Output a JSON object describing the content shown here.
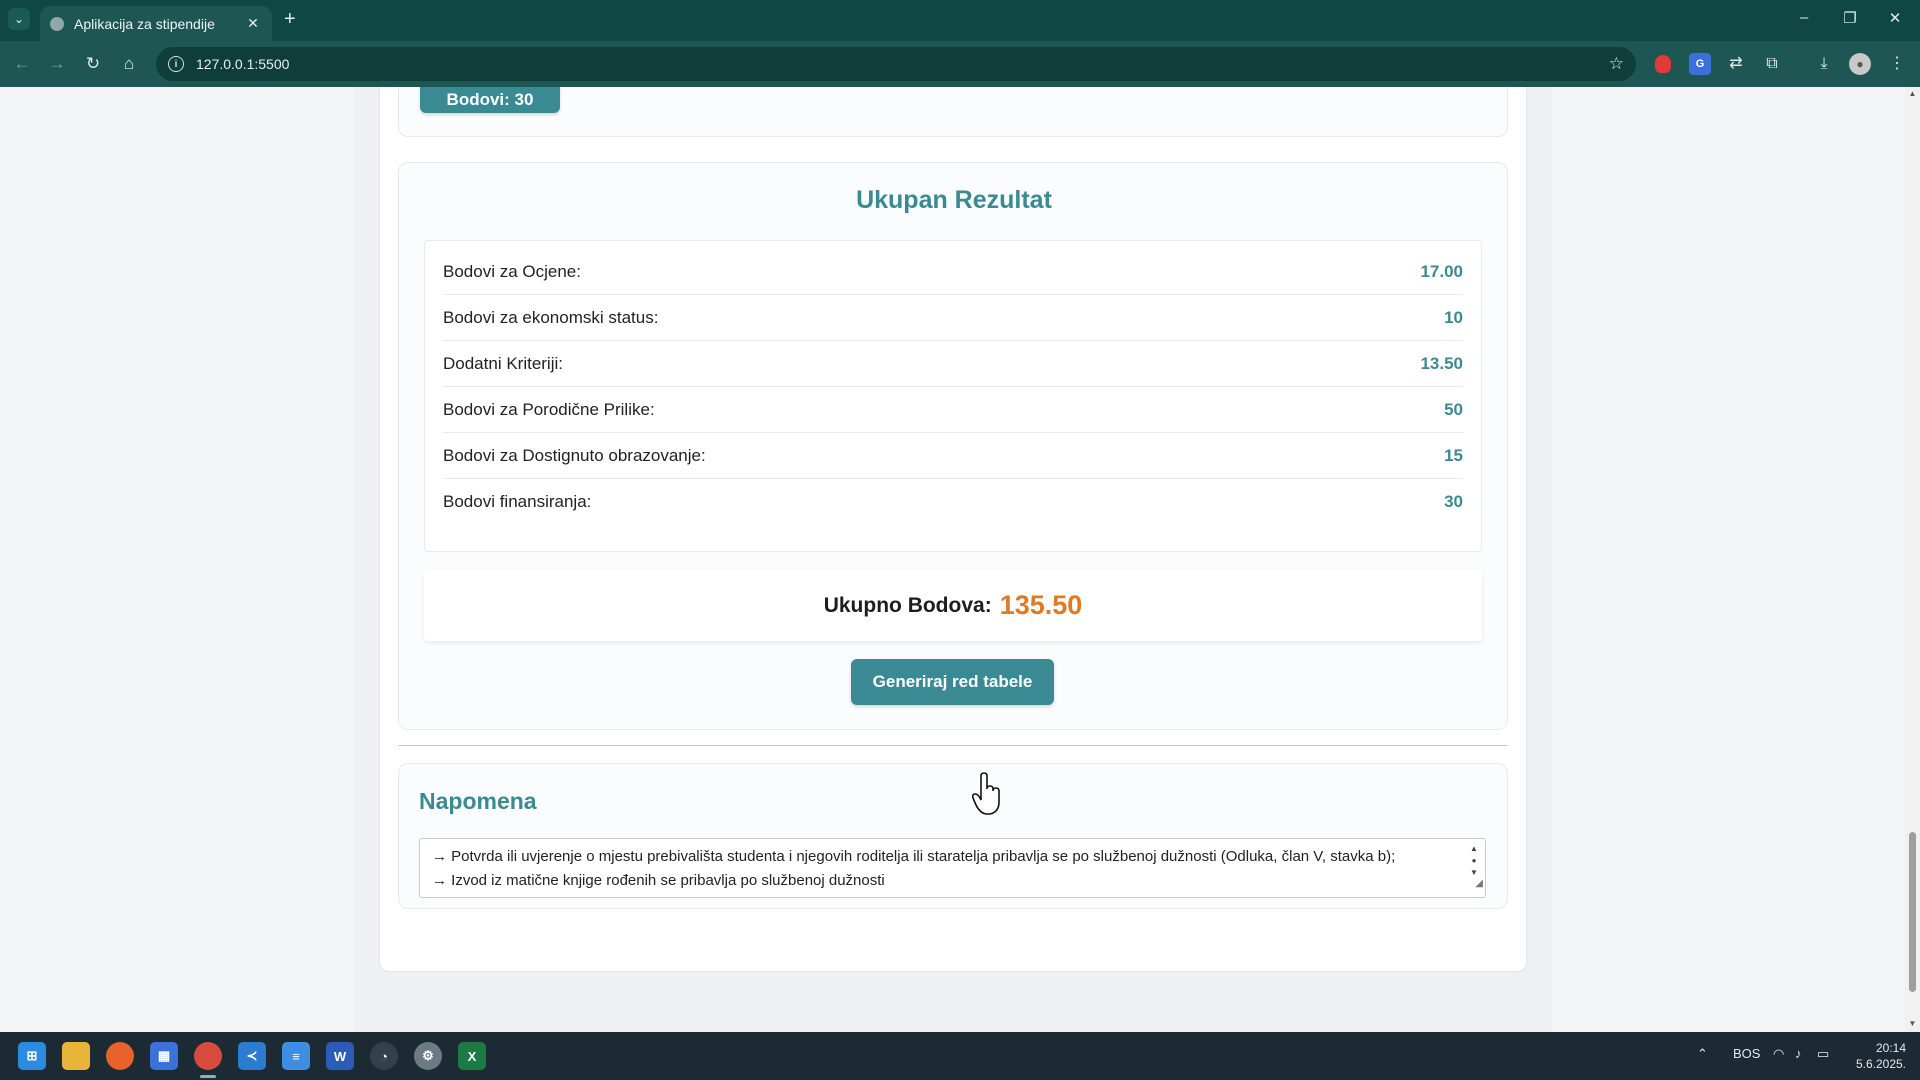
{
  "browser": {
    "tab_title": "Aplikacija za stipendije",
    "url": "127.0.0.1:5500"
  },
  "page": {
    "previous_card_button": "Bodovi: 30",
    "result": {
      "title": "Ukupan Rezultat",
      "rows": [
        {
          "label": "Bodovi za Ocjene:",
          "value": "17.00"
        },
        {
          "label": "Bodovi za ekonomski status:",
          "value": "10"
        },
        {
          "label": "Dodatni Kriteriji:",
          "value": "13.50"
        },
        {
          "label": "Bodovi za Porodične Prilike:",
          "value": "50"
        },
        {
          "label": "Bodovi za Dostignuto obrazovanje:",
          "value": "15"
        },
        {
          "label": "Bodovi finansiranja:",
          "value": "30"
        }
      ],
      "total_label": "Ukupno Bodova:",
      "total_value": "135.50",
      "generate_button": "Generiraj red tabele"
    },
    "note": {
      "title": "Napomena",
      "lines": [
        "→ Potvrda ili uvjerenje o mjestu prebivališta studenta i njegovih roditelja ili staratelja pribavlja se po službenoj dužnosti (Odluka, član V, stavka b);",
        "→ Izvod iz matične knjige rođenih se pribavlja po službenoj dužnosti"
      ]
    }
  },
  "taskbar": {
    "language": "BOS",
    "time": "20:14",
    "date": "5.6.2025."
  },
  "colors": {
    "accent": "#3a8a94",
    "total": "#e07a22",
    "browser_frame": "#1d5652"
  }
}
